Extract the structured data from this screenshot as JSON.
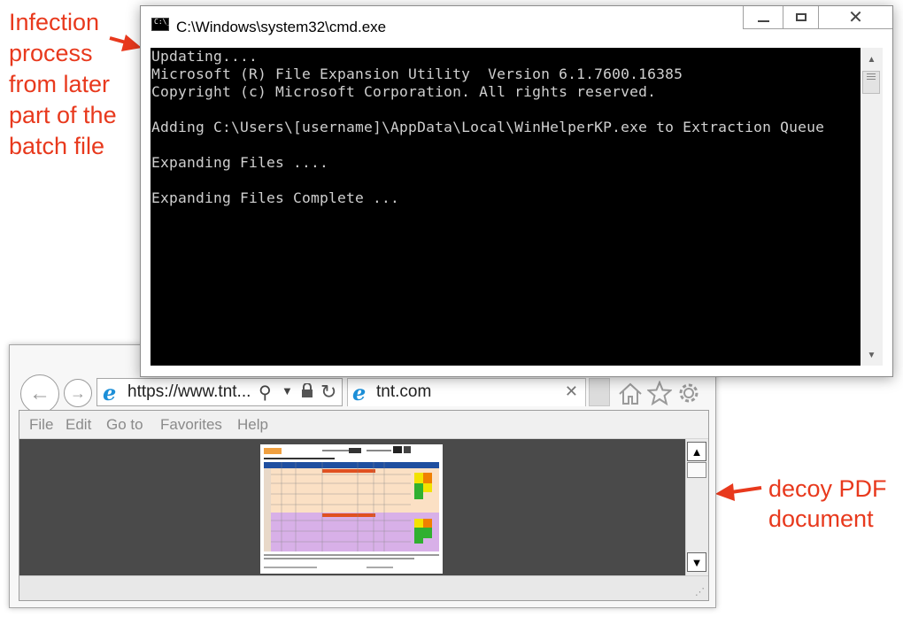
{
  "annotations": {
    "left": [
      "Infection",
      "process",
      "from later",
      "part of the",
      "batch file"
    ],
    "right": [
      "decoy PDF",
      "document"
    ]
  },
  "cmd": {
    "title": "C:\\Windows\\system32\\cmd.exe",
    "lines": [
      "Updating....",
      "Microsoft (R) File Expansion Utility  Version 6.1.7600.16385",
      "Copyright (c) Microsoft Corporation. All rights reserved.",
      "",
      "Adding C:\\Users\\[username]\\AppData\\Local\\WinHelperKP.exe to Extraction Queue",
      "",
      "Expanding Files ....",
      "",
      "Expanding Files Complete ..."
    ]
  },
  "ie": {
    "address": "https://www.tnt...",
    "tab_title": "tnt.com",
    "menu": [
      "File",
      "Edit",
      "Go to",
      "Favorites",
      "Help"
    ],
    "icons": [
      "back-arrow-icon",
      "forward-arrow-icon",
      "search-icon",
      "lock-icon",
      "refresh-icon",
      "home-icon",
      "star-icon",
      "gear-icon"
    ]
  }
}
